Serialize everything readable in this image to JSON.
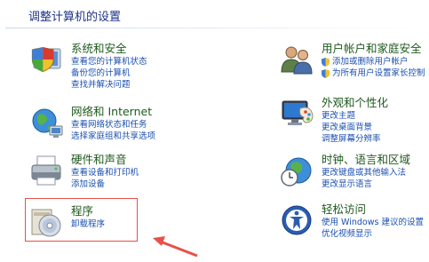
{
  "page": {
    "title": "调整计算机的设置"
  },
  "left_column": [
    {
      "key": "system",
      "heading": "系统和安全",
      "icon": "system-security-shield-icon",
      "links": [
        "查看您的计算机状态",
        "备份您的计算机",
        "查找并解决问题"
      ]
    },
    {
      "key": "network",
      "heading": "网络和 Internet",
      "icon": "network-globe-icon",
      "links": [
        "查看网络状态和任务",
        "选择家庭组和共享选项"
      ]
    },
    {
      "key": "hardware",
      "heading": "硬件和声音",
      "icon": "printer-icon",
      "links": [
        "查看设备和打印机",
        "添加设备"
      ]
    },
    {
      "key": "programs",
      "heading": "程序",
      "icon": "programs-disc-icon",
      "links": [
        "卸载程序"
      ]
    }
  ],
  "right_column": [
    {
      "key": "accounts",
      "heading": "用户帐户和家庭安全",
      "icon": "users-icon",
      "links": [
        "添加或删除用户帐户",
        "为所有用户设置家长控制"
      ]
    },
    {
      "key": "appearance",
      "heading": "外观和个性化",
      "icon": "monitor-palette-icon",
      "links": [
        "更改主题",
        "更改桌面背景",
        "调整屏幕分辨率"
      ]
    },
    {
      "key": "clock",
      "heading": "时钟、语言和区域",
      "icon": "clock-globe-icon",
      "links": [
        "更改键盘或其他输入法",
        "更改显示语言"
      ]
    },
    {
      "key": "ease",
      "heading": "轻松访问",
      "icon": "ease-of-access-icon",
      "links": [
        "使用 Windows 建议的设置",
        "优化视频显示"
      ]
    }
  ],
  "annotation": {
    "box_color": "#e8504a",
    "arrow_color": "#e8504a"
  }
}
